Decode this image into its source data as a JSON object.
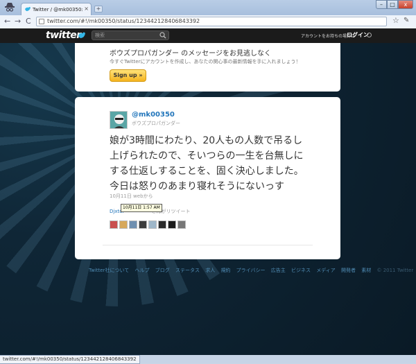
{
  "browser": {
    "tab_title": "Twitter / @mk00350: 娘が3時間…",
    "tab_close": "×",
    "new_tab": "+",
    "url": "twitter.com/#!/mk00350/status/123442128406843392",
    "back": "←",
    "forward": "→",
    "reload": "C",
    "min": "–",
    "max": "□",
    "close": "x",
    "star": "☆",
    "wrench": "✎"
  },
  "twitter_bar": {
    "logo": "twitter",
    "search_placeholder": "検索",
    "account_question": "アカウントをお持ちの場合は",
    "login": "ログイン"
  },
  "promo": {
    "title": "ボウズプロパガンダー のメッセージをお見逃しなく",
    "subtitle": "今すぐTwitterにアカウントを作成し、あなたの関心事の最新情報を手に入れましょう！",
    "signup": "Sign up »"
  },
  "tweet": {
    "handle": "@mk00350",
    "name": "ボウズプロパガンダー",
    "text": "娘が3時間にわたり、20人もの人数で吊るし上げられたので、そいつらの一生を台無しにする仕返しすることを、固く決心しました。今日は怒りのあまり寝れそうにないっす",
    "meta": "10月11日 webから",
    "retweet_link": "Djxtoi",
    "retweet_suffix": "さんがリツイート",
    "tooltip": "10月11日 1:57 AM"
  },
  "faces": [
    "#c94f4f",
    "#d7a85b",
    "#6f8fb0",
    "#3c3c3c",
    "#9fb7c9",
    "#2a2a2a",
    "#1b1b1b",
    "#777777"
  ],
  "footer": {
    "links": [
      "Twitter社について",
      "ヘルプ",
      "ブログ",
      "ステータス",
      "求人",
      "規約",
      "プライバシー",
      "広告主",
      "ビジネス",
      "メディア",
      "開発者",
      "素材"
    ],
    "copyright": "© 2011 Twitter"
  },
  "statusbar": {
    "text": "twitter.com/#!/mk00350/status/123442128406843392"
  }
}
